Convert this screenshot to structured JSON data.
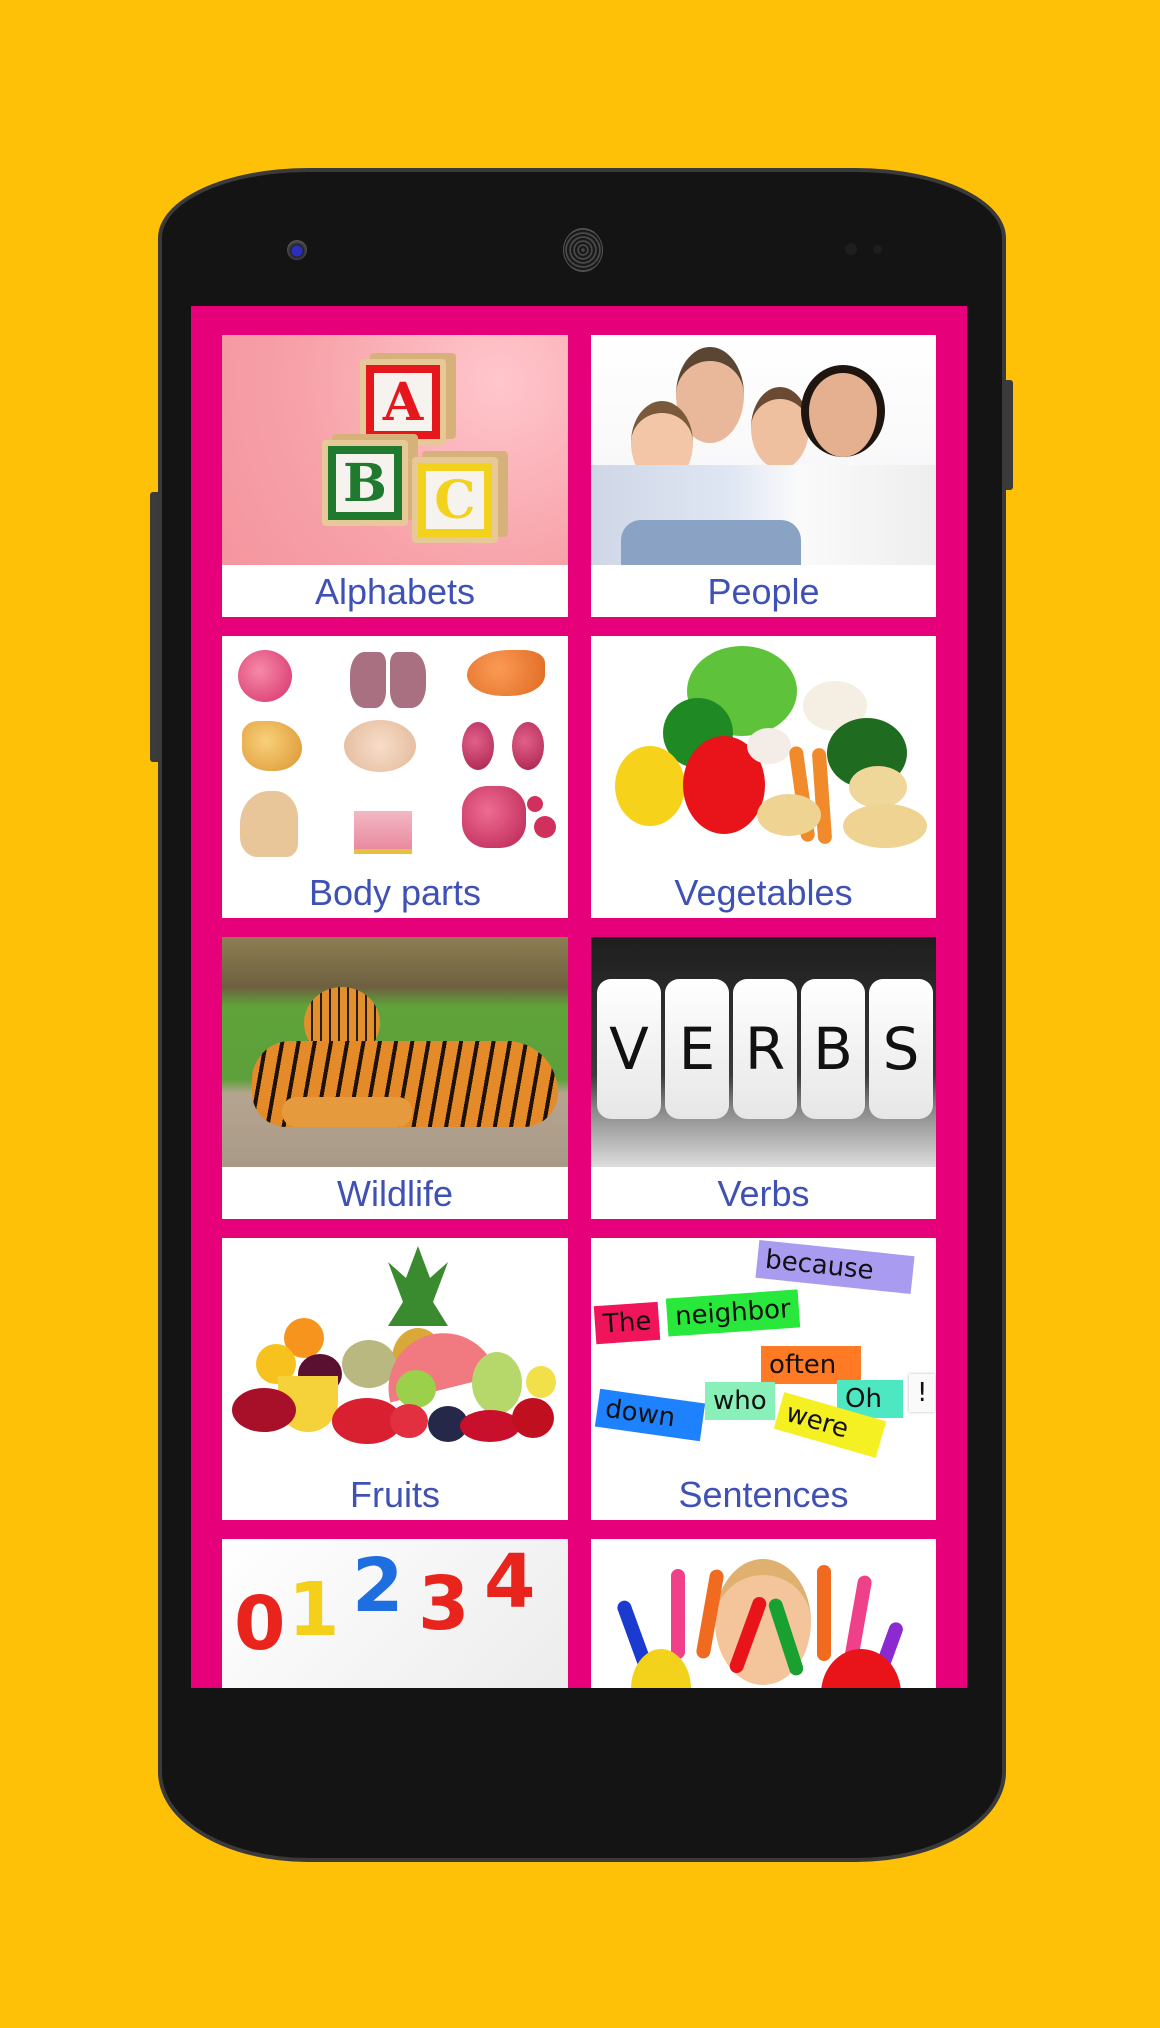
{
  "device": {
    "background_color": "#ffc107",
    "screen_color": "#e6007a",
    "label_color": "#3f51b5"
  },
  "categories": [
    {
      "label": "Alphabets",
      "image": "abc-blocks"
    },
    {
      "label": "People",
      "image": "family-photo"
    },
    {
      "label": "Body parts",
      "image": "organs-illustration"
    },
    {
      "label": "Vegetables",
      "image": "vegetables-photo"
    },
    {
      "label": "Wildlife",
      "image": "tiger-photo"
    },
    {
      "label": "Verbs",
      "image": "verbs-letter-tiles"
    },
    {
      "label": "Fruits",
      "image": "fruits-photo"
    },
    {
      "label": "Sentences",
      "image": "word-cards"
    },
    {
      "label": "",
      "image": "numbers-magnets"
    },
    {
      "label": "",
      "image": "painted-hands"
    }
  ],
  "illustration_text": {
    "abc_letters": [
      "A",
      "B",
      "C"
    ],
    "verbs_letters": [
      "V",
      "E",
      "R",
      "B",
      "S"
    ],
    "sentence_words": [
      "because",
      "The",
      "neighbor",
      "often",
      "who",
      "Oh",
      "down",
      "were",
      "!"
    ],
    "numbers": [
      "0",
      "1",
      "2",
      "3",
      "4"
    ]
  }
}
